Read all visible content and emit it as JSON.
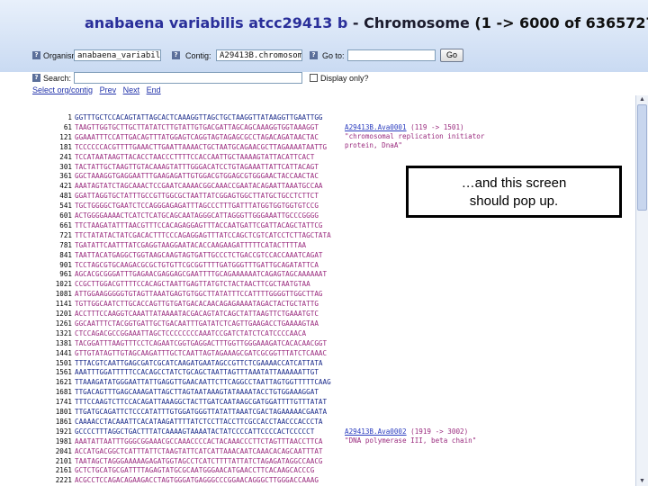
{
  "title": {
    "org": "anabaena variabilis atcc29413 b",
    "sep": " - Chromosome ",
    "range": "(1 -> 6000 of 6365727)"
  },
  "form": {
    "organism_label": "Organism:",
    "organism_value": "anabaena_variabilis_at",
    "contig_label": "Contig:",
    "contig_value": "A29413B.chromosome",
    "goto_label": "Go to:",
    "goto_value": "",
    "go_button": "Go",
    "search_label": "Search:",
    "search_value": "",
    "display_only_label": "Display only?",
    "help_glyph": "?"
  },
  "nav": {
    "select": "Select org/contig",
    "prev": "Prev",
    "next": "Next",
    "end": "End"
  },
  "rows": [
    {
      "n": "1",
      "s": "GGTTTGCTCCACAGTATTAGCACTCAAAGGTTAGCTGCTAAGGTTATAAGGTTGAATTGG",
      "t": "n"
    },
    {
      "n": "61",
      "s": "TAAGTTGGTGCTTGCTTATATCTTGTATTGTGACGATTAGCAGCAAAGGTGGTAAAGGT",
      "t": "g"
    },
    {
      "n": "121",
      "s": "GGAAATTTCCATTGACAGTTTATGGAGTCAGGTAGTAGAGCGCCTAGACAGATAACTAC",
      "t": "g"
    },
    {
      "n": "181",
      "s": "TCCCCCCACGTTTTGAAACTTGAATTAAAACTGCTAATGCAGAACGCTTAGAAAATAATTG",
      "t": "g"
    },
    {
      "n": "241",
      "s": "TCCATAATAAGTTACACCTAACCCTTTTCCACCAATTGCTAAAAGTATTACATTCACT",
      "t": "g"
    },
    {
      "n": "301",
      "s": "TACTATTGCTAAGTTGTACAAAGTATTTGGGACATCCTGTAGAAATTATTCATTACAGT",
      "t": "g"
    },
    {
      "n": "361",
      "s": "GGCTAAAGGTGAGGAATTTGAAGAGATTGTGGACGTGGAGCGTGGGAACTACCAACTAC",
      "t": "g"
    },
    {
      "n": "421",
      "s": "AAATAGTATCTAGCAAACTCCGAATCAAAACGGCAAACCGAATACAGAATTAAATGCCAA",
      "t": "g"
    },
    {
      "n": "481",
      "s": "GGATTAGGTGCTATTTGCCGTTGGCGCTAATTATCGGAGTGGCTTATGCTGCCTCTTCT",
      "t": "g"
    },
    {
      "n": "541",
      "s": "TGCTGGGGCTGAATCTCCAGGGAGAGATTTAGCCCTTTGATTTATGGTGGTGGTGTCCG",
      "t": "g"
    },
    {
      "n": "601",
      "s": "ACTGGGGAAAACTCATCTCATGCAGCAATAGGGCATTAGGGTTGGGAAATTGCCCGGGG",
      "t": "g"
    },
    {
      "n": "661",
      "s": "TTCTAAGATATTTAACGTTTCCACAGAGGAGTTTACCAATGATTCGATTACAGCTATTCG",
      "t": "g"
    },
    {
      "n": "721",
      "s": "TTCTATATACTATCGACACTTTCCCAGAGGAGTTTATCCAGCTCGTCATCCTCTTAGCTATA",
      "t": "g"
    },
    {
      "n": "781",
      "s": "TGATATTCAATTTATCGAGGTAAGGAATACACCAAGAAGATTTTTCATACTTTTAA",
      "t": "g"
    },
    {
      "n": "841",
      "s": "TAATTACATGAGGCTGGTAAGCAAGTAGTGATTGCCCTCTGACCGTCCACCAAATCAGAT",
      "t": "g"
    },
    {
      "n": "901",
      "s": "TCCTAGCGTGCAAGACGCGCTGTGTTCGCGGTTTTGATGGGTTTGATTGCAGATATTCA",
      "t": "g"
    },
    {
      "n": "961",
      "s": "AGCACGCGGGATTTGAGAACGAGGAGCGAATTTTGCAGAAAAAATCAGAGTAGCAAAAAAT",
      "t": "g"
    },
    {
      "n": "1021",
      "s": "CCGCTTGGACGTTTTCCACAGCTAATTGAGTTATGTCTACTAACTTCGCTAATGTAA",
      "t": "g"
    },
    {
      "n": "1081",
      "s": "ATTGGAAGGGGGTGTAGTTAAATGAGTGTGGCTTATATTTCCATTTTGGGGTTGGCTTAG",
      "t": "g"
    },
    {
      "n": "1141",
      "s": "TGTTGGCAATCTTGCACCAGTTGTGATGACACAACAGAGAAAATAGACTACTGCTATTG",
      "t": "g"
    },
    {
      "n": "1201",
      "s": "ACCTTTCCAAGGTCAAATTATAAAATACGACAGTATCAGCTATTAAGTTCTGAAATGTC",
      "t": "g"
    },
    {
      "n": "1261",
      "s": "GGCAATTTCTACGGTGATTGCTGACAATTTGATATCTCAGTTGAAGACCTGAAAAGTAA",
      "t": "g"
    },
    {
      "n": "1321",
      "s": "CTCCAGACGCCGGAAATTAGCTCCCCCCCCAAATCCGATCTATCTCATCCCCAACA",
      "t": "g"
    },
    {
      "n": "1381",
      "s": "TACGGATTTAAGTTTCCTCAGAATCGGTGAGGACTTTGGTTGGGAAAGATCACACAACGGT",
      "t": "g"
    },
    {
      "n": "1441",
      "s": "GTTGTATAGTTGTAGCAAGATTTGCTCAATTAGTAGAAAGCGATCGCGGTTTATCTCAAAC",
      "t": "g"
    },
    {
      "n": "1501",
      "s": "TTTACGTCAATTGAGCGATCGCATCAAGATGAATAGCCGTTCTCGAAAACCATCATTATA",
      "t": "n"
    },
    {
      "n": "1561",
      "s": "AAATTTGGATTTTTCCACAGCCTATCTGCAGCTAATTAGTTTAAATATTAAAAAATTGT",
      "t": "n"
    },
    {
      "n": "1621",
      "s": "TTAAAGATATGGGAATTATTGAGGTTGAACAATTCTTCAGGCCTAATTAGTGGTTTTTCAAG",
      "t": "n"
    },
    {
      "n": "1681",
      "s": "TTGACAGTTTGAGCAAAGATTAGCTTAGTAATAAAGTATAAAATACCTGTGGAAAGGAT",
      "t": "n"
    },
    {
      "n": "1741",
      "s": "TTTCCAAGTCTTCCACAGATTAAAGGCTACTTGATCAATAAGCGATGGATTTTGTTTATAT",
      "t": "n"
    },
    {
      "n": "1801",
      "s": "TTGATGCAGATTCTCCCATATTTGTGGATGGGTTATATTAAATCGACTAGAAAAACGAATA",
      "t": "n"
    },
    {
      "n": "1861",
      "s": "CAAAACCTACAAATTCACATAAGATTTTATCTCCTTACCTTCGCCACCTAACCCACCCTA",
      "t": "n"
    },
    {
      "n": "1921",
      "s": "GCCCCTTTAGGCTGACTTTATCAAAAGTAAAATACTATCCCCATTCCCCACTCCCCCT",
      "t": "n"
    },
    {
      "n": "1981",
      "s": "AAATATTAATTTGGGCGGAAACGCCAAACCCCACTACAAACCCTTCTAGTTTAACCTTCA",
      "t": "g"
    },
    {
      "n": "2041",
      "s": "ACCATGACGGCTCATTTATTCTAAGTATTCATCATTAAACAATCAAACACAGCAATTTAT",
      "t": "g"
    },
    {
      "n": "2101",
      "s": "TAATAGCTAGGGAAAAAGAGATGGTAGCCTCATCTTTTATTATCTAGAGATAGGCCAACG",
      "t": "g"
    },
    {
      "n": "2161",
      "s": "GCTCTGCATGCGATTTTAGAGTATGCGCAATGGGAACATGAACCTTCACAAGCACCCG",
      "t": "g"
    },
    {
      "n": "2221",
      "s": "ACGCCTCCAGACAGAAGACCTAGTGGGATGAGGGCCCGGAACAGGGCTTGGGACCAAAG",
      "t": "g"
    },
    {
      "n": "2281",
      "s": "CGCACGTGCACGCTGTCGCATCGCTGTAGTCTTTCGACTACCCCTTACCCCCAACTAG",
      "t": "g"
    }
  ],
  "annotations": [
    {
      "link": "A29413B.Ava0001",
      "range": " (119 -> 1501)",
      "lines": [
        "\"chromosomal replication initiator",
        "protein, DnaA\""
      ]
    },
    {
      "link": "A29413B.Ava0002",
      "range": " (1919 -> 3002)",
      "lines": [
        "\"DNA polymerase III, beta chain\""
      ]
    }
  ],
  "popup": {
    "line1": "…and this screen",
    "line2": "should pop up."
  },
  "scroll": {
    "up": "▲",
    "down": "▼"
  }
}
